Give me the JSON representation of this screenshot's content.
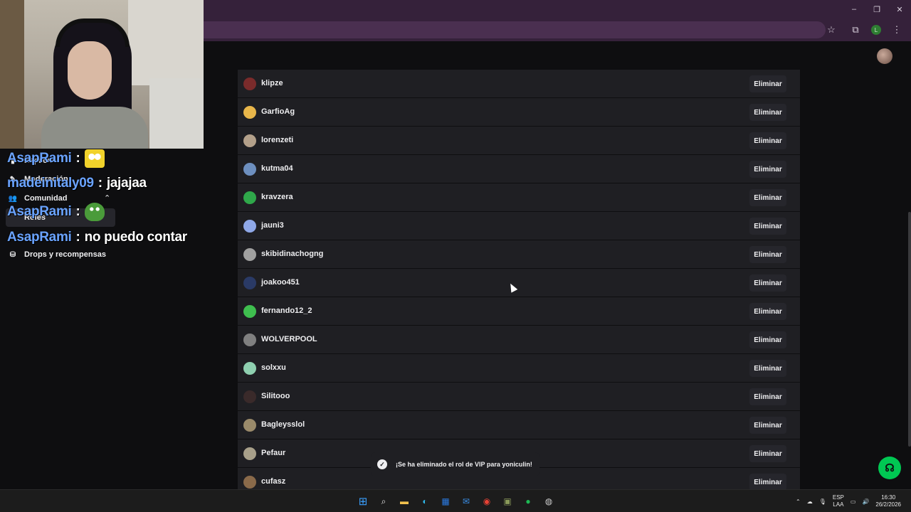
{
  "chat": [
    {
      "user": "AsapRami",
      "sep": ":",
      "text": "",
      "emote": "spongebob-emote"
    },
    {
      "user": "madeinitaly09",
      "sep": ":",
      "text": "jajajaa",
      "emote": ""
    },
    {
      "user": "AsapRami",
      "sep": ":",
      "text": "",
      "emote": "pepe-emote"
    },
    {
      "user": "AsapRami",
      "sep": ":",
      "text": "no puedo contar",
      "emote": ""
    }
  ],
  "sidebar": {
    "items": [
      {
        "label": "Espacio",
        "icon": "chart-icon"
      },
      {
        "label": "Moderación",
        "icon": "sword-icon"
      },
      {
        "label": "Comunidad",
        "icon": "people-icon"
      },
      {
        "label": "Roles"
      },
      {
        "label": "Drops y recompensas",
        "icon": "gift-icon"
      }
    ]
  },
  "users": [
    {
      "name": "klipze",
      "color": "#7a2b2b"
    },
    {
      "name": "GarfioAg",
      "color": "#e8b64a"
    },
    {
      "name": "lorenzeti",
      "color": "#b3a08a"
    },
    {
      "name": "kutma04",
      "color": "#6d8fbf"
    },
    {
      "name": "kravzera",
      "color": "#2fa84a"
    },
    {
      "name": "jauni3",
      "color": "#8fa8e8"
    },
    {
      "name": "skibidinachogng",
      "color": "#a0a0a0"
    },
    {
      "name": "joakoo451",
      "color": "#2a3a66"
    },
    {
      "name": "fernando12_2",
      "color": "#3fbf4f"
    },
    {
      "name": "WOLVERPOOL",
      "color": "#808080"
    },
    {
      "name": "solxxu",
      "color": "#8fd0b0"
    },
    {
      "name": "Silitooo",
      "color": "#3a2a2a"
    },
    {
      "name": "Bagleysslol",
      "color": "#9a8a6a"
    },
    {
      "name": "Pefaur",
      "color": "#a8a08a"
    },
    {
      "name": "cufasz",
      "color": "#8a6a4a"
    }
  ],
  "remove_label": "Eliminar",
  "toast": "¡Se ha eliminado el rol de VIP para yoniculin!",
  "tray": {
    "lang1": "ESP",
    "lang2": "LAA",
    "time": "16:30",
    "date": "26/2/2026"
  },
  "window_controls": [
    "–",
    "❐",
    "✕"
  ],
  "colors": {
    "accent": "#00c853",
    "chat_user": "#6aa3ff",
    "browser": "#35213a"
  }
}
